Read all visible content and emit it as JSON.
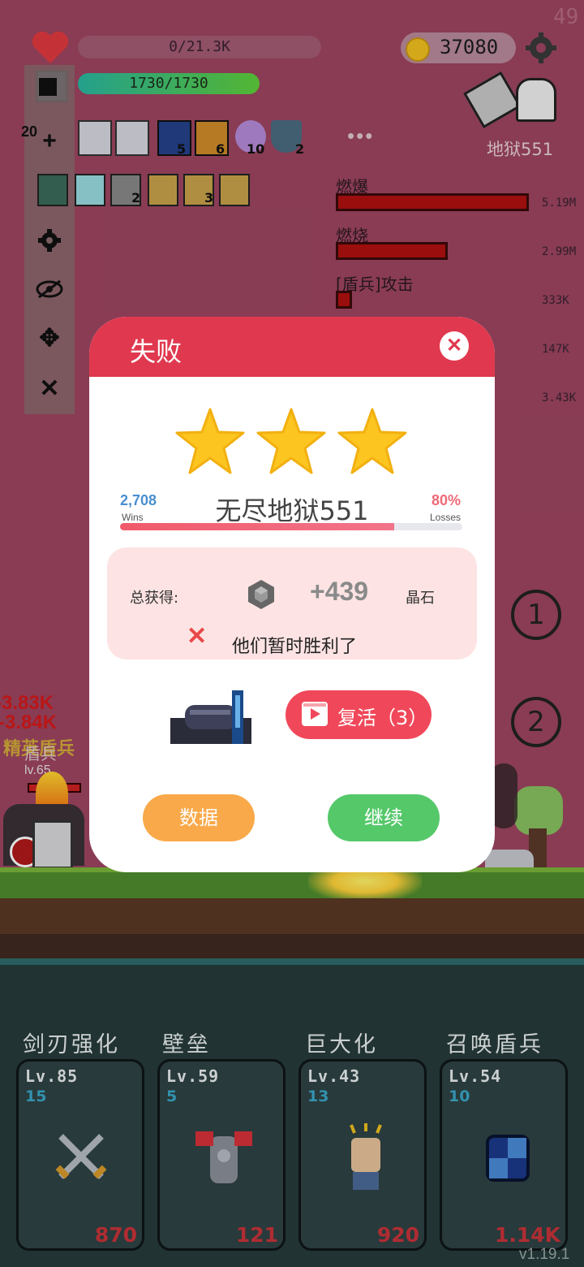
{
  "hud": {
    "hp_text": "0/21.3K",
    "shield_text": "1730/1730",
    "gold": "37080",
    "corner_number": "49",
    "level_text": "地狱551",
    "item_counts": [
      "5",
      "6",
      "10",
      "2"
    ],
    "item_counts_row2": [
      "2",
      "3"
    ],
    "left_badge": "20"
  },
  "damage": {
    "rows": [
      {
        "label": "燃爆",
        "value": "5.19M"
      },
      {
        "label": "燃烧",
        "value": "2.99M"
      },
      {
        "label": "[盾兵]攻击",
        "value": "333K"
      },
      {
        "label": "",
        "value": "147K"
      },
      {
        "label": "",
        "value": "3.43K"
      }
    ],
    "fills": [
      1.0,
      0.58,
      0.04
    ]
  },
  "scene": {
    "enemy_name": "精英盾兵",
    "enemy_sub": "盾兵",
    "enemy_lv": "lv.65",
    "dmg_popup1": "-3.83K",
    "dmg_popup2": "-3.84K",
    "target_1": "1",
    "target_2": "2"
  },
  "modal": {
    "title": "失败",
    "stars": 3,
    "wins_count": "2,708",
    "wins_label": "Wins",
    "stage_name": "无尽地狱551",
    "loss_pct": "80%",
    "losses_label": "Losses",
    "progress": 0.8,
    "reward_label": "总获得:",
    "reward_amount": "+439",
    "reward_unit": "晶石",
    "result_text": "他们暂时胜利了",
    "revive_label": "复活（3）",
    "stats_button": "数据",
    "continue_button": "继续"
  },
  "skills": [
    {
      "name": "剑刃强化",
      "lv": "Lv.85",
      "sub": "15",
      "cost": "870"
    },
    {
      "name": "壁垒",
      "lv": "Lv.59",
      "sub": "5",
      "cost": "121"
    },
    {
      "name": "巨大化",
      "lv": "Lv.43",
      "sub": "13",
      "cost": "920"
    },
    {
      "name": "召唤盾兵",
      "lv": "Lv.54",
      "sub": "10",
      "cost": "1.14K"
    }
  ],
  "version": "v1.19.1",
  "colors": {
    "accent": "#e0394f",
    "stats": "#f9a94a",
    "continue": "#55c86a",
    "reward_bg": "#fde3e3"
  }
}
